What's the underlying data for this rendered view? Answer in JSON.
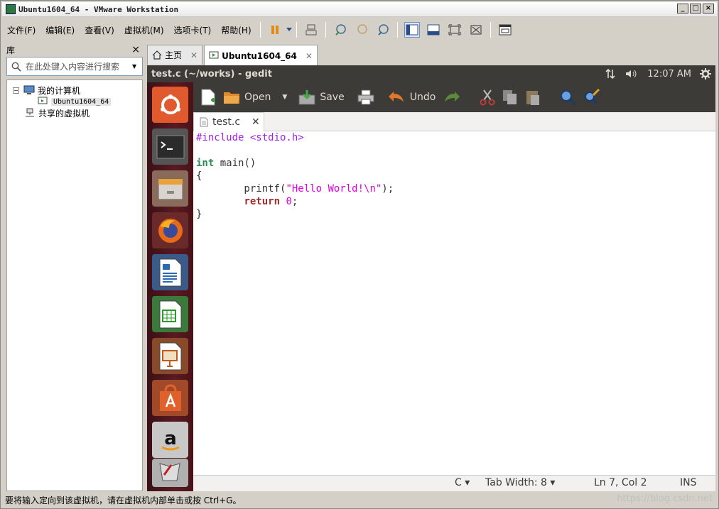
{
  "window": {
    "title": "Ubuntu1604_64 - VMware Workstation",
    "min": "_",
    "max": "□",
    "close": "×"
  },
  "menu": [
    {
      "label": "文件(F)"
    },
    {
      "label": "编辑(E)"
    },
    {
      "label": "查看(V)"
    },
    {
      "label": "虚拟机(M)"
    },
    {
      "label": "选项卡(T)"
    },
    {
      "label": "帮助(H)"
    }
  ],
  "library": {
    "title": "库",
    "close": "×",
    "search_placeholder": "在此处键入内容进行搜索",
    "tree": {
      "root": "我的计算机",
      "vm": "Ubuntu1604_64",
      "shared": "共享的虚拟机",
      "expander": "−"
    }
  },
  "tabs": {
    "home": "主页",
    "vm": "Ubuntu1604_64",
    "close": "✕"
  },
  "guest": {
    "title": "test.c (~/works) - gedit",
    "time": "12:07 AM",
    "toolbar": {
      "open": "Open",
      "save": "Save",
      "undo": "Undo"
    },
    "doc_tab": "test.c",
    "doc_tab_close": "✕",
    "status": {
      "lang": "C ▾",
      "tab_width": "Tab Width: 8 ▾",
      "pos": "Ln 7, Col 2",
      "ins": "INS"
    }
  },
  "code": {
    "l1a": "#include ",
    "l1b": "<stdio.h>",
    "l3a": "int",
    "l3b": " main()",
    "l4": "{",
    "l5a": "        printf(",
    "l5b": "\"Hello World!\\n\"",
    "l5c": ");",
    "l6a": "        ",
    "l6b": "return",
    "l6c": " ",
    "l6d": "0",
    "l6e": ";",
    "l7": "}"
  },
  "statusbar": "要将输入定向到该虚拟机，请在虚拟机内部单击或按 Ctrl+G。",
  "watermark": "https://blog.csdn.net"
}
